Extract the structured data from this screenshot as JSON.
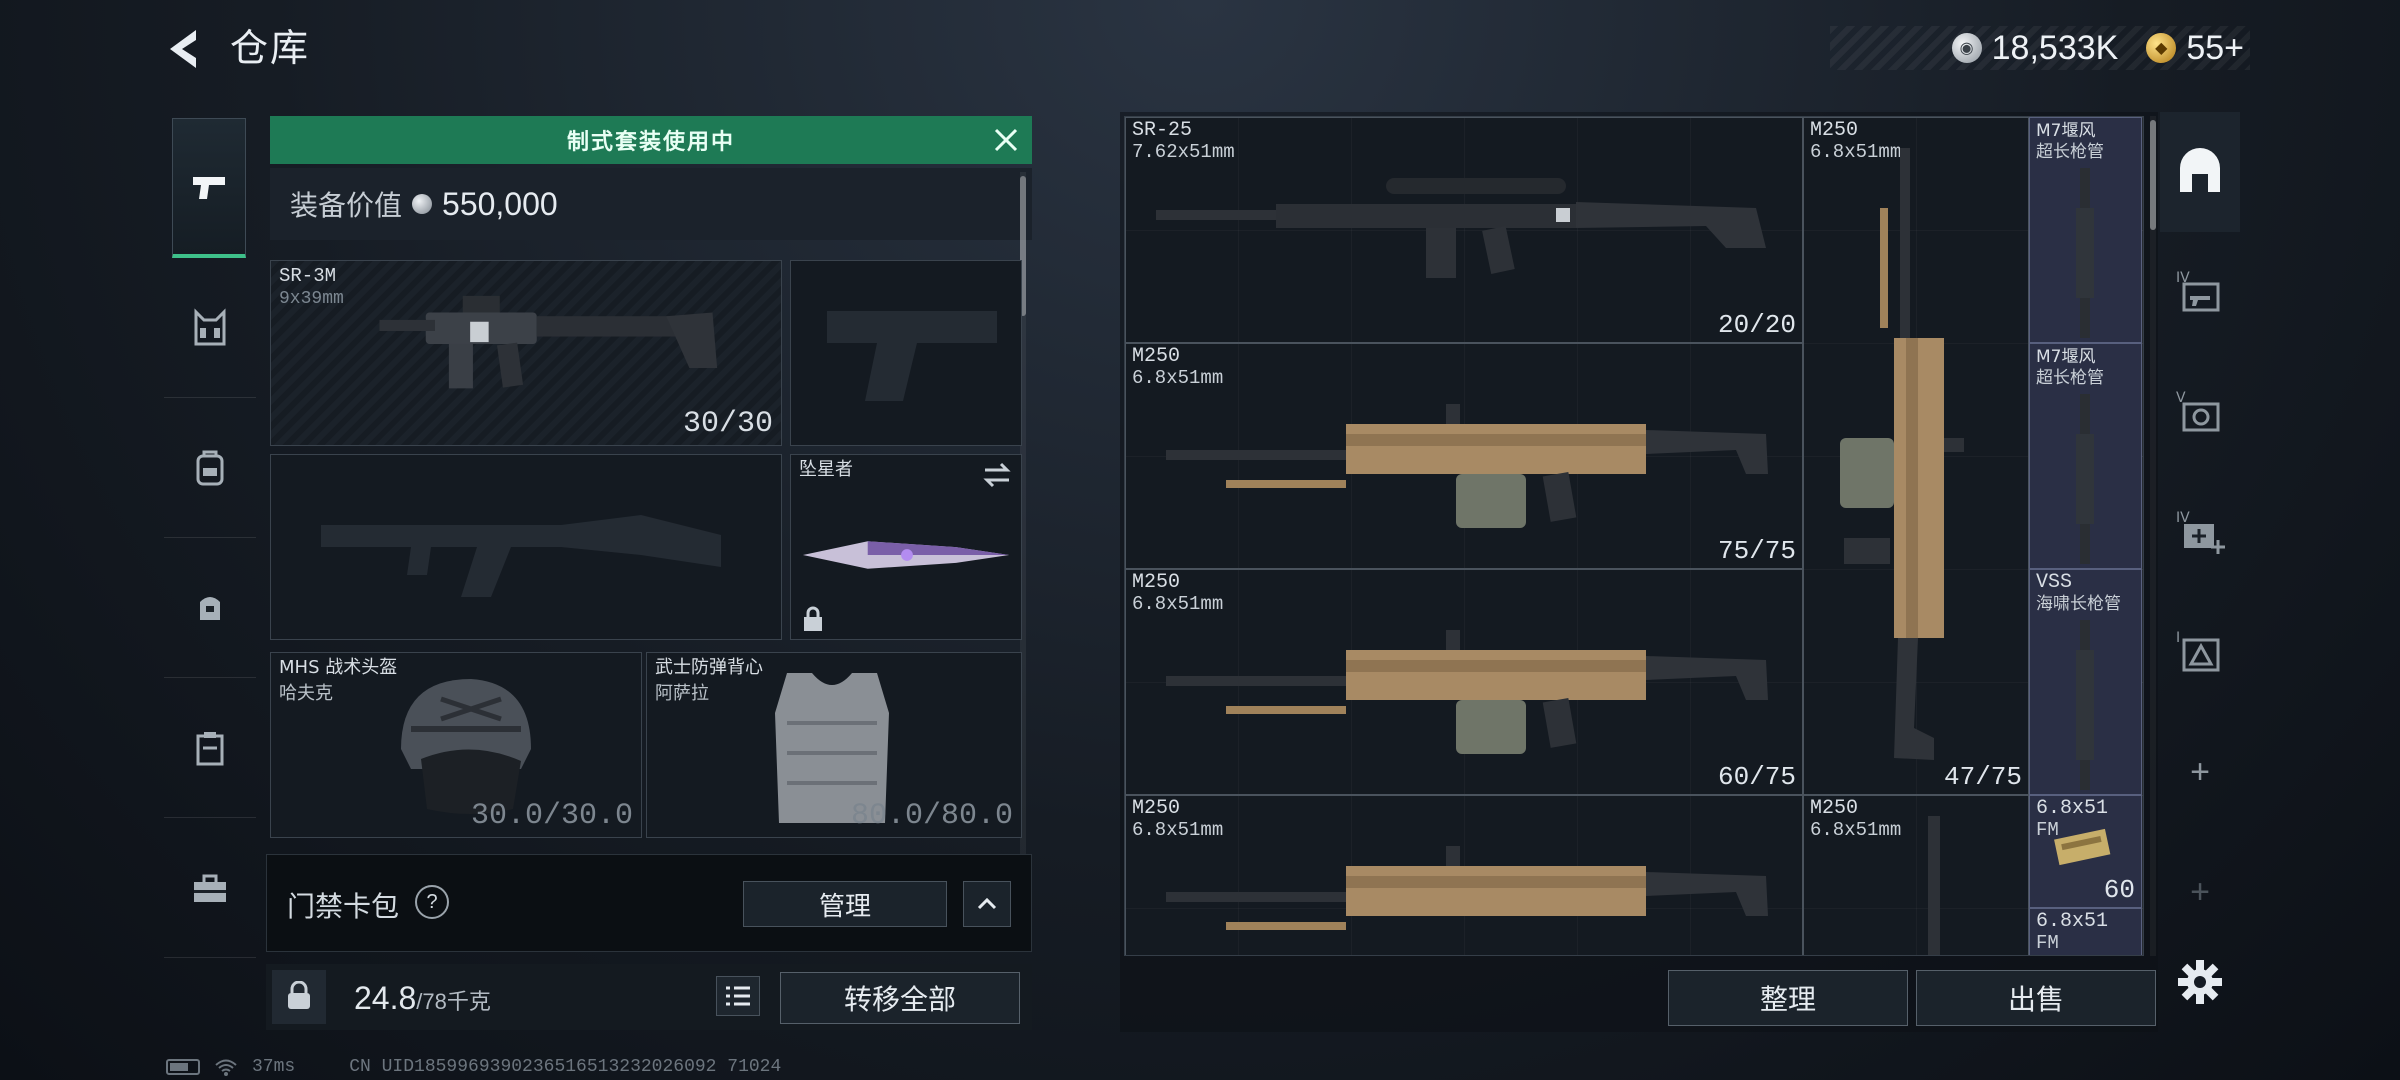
{
  "header": {
    "title": "仓库",
    "silver_amount": "18,533K",
    "gold_amount": "55+"
  },
  "loadout": {
    "banner": "制式套装使用中",
    "value_label": "装备价值",
    "value": "550,000",
    "slots": {
      "primary": {
        "name": "SR-3M",
        "caliber": "9x39mm",
        "ammo": "30/30"
      },
      "melee": {
        "name": "坠星者"
      },
      "helmet": {
        "name": "MHS 战术头盔",
        "sub": "哈夫克",
        "durability": "30.0/30.0"
      },
      "armor": {
        "name": "武士防弹背心",
        "sub": "阿萨拉",
        "durability": "80.0/80.0"
      }
    },
    "keycard": {
      "label": "门禁卡包",
      "help": "?",
      "manage": "管理"
    },
    "weight": {
      "current": "24.8",
      "max": "/78千克"
    },
    "transfer_all": "转移全部"
  },
  "stash": {
    "items": [
      {
        "name": "SR-25",
        "caliber": "7.62x51mm",
        "count": "20/20"
      },
      {
        "name": "M250",
        "caliber": "6.8x51mm",
        "count": "75/75"
      },
      {
        "name": "M250",
        "caliber": "6.8x51mm",
        "count": "60/75"
      },
      {
        "name": "M250",
        "caliber": "6.8x51mm",
        "count": ""
      },
      {
        "name": "M250",
        "caliber": "6.8x51mm",
        "count": "47/75"
      },
      {
        "name": "M250",
        "caliber": "6.8x51mm",
        "count": ""
      },
      {
        "name": "M7堰风",
        "caliber": "超长枪管",
        "count": ""
      },
      {
        "name": "M7堰风",
        "caliber": "超长枪管",
        "count": ""
      },
      {
        "name": "VSS",
        "caliber": "海啸长枪管",
        "count": ""
      },
      {
        "name": "6.8x51",
        "caliber": "FM",
        "count": "60"
      },
      {
        "name": "6.8x51",
        "caliber": "FM",
        "count": ""
      }
    ],
    "sort_label": "整理",
    "sell_label": "出售"
  },
  "status": {
    "ping": "37ms",
    "uid": "CN UID1859969390236516513232026092 71024"
  },
  "colors": {
    "accent_green": "#1e7a55",
    "active_underline": "#3ec08a",
    "panel_bg": "#141a21"
  },
  "icons": {
    "rail": [
      "pistol-icon",
      "chest-rig-icon",
      "backpack-icon",
      "pouch-icon",
      "clipboard-icon",
      "toolbox-icon"
    ],
    "tools": [
      "home-arch-icon",
      "gun-storage-icon",
      "camera-storage-icon",
      "medkit-storage-icon",
      "warning-storage-icon",
      "plus-icon",
      "plus-icon",
      "gear-icon"
    ]
  }
}
